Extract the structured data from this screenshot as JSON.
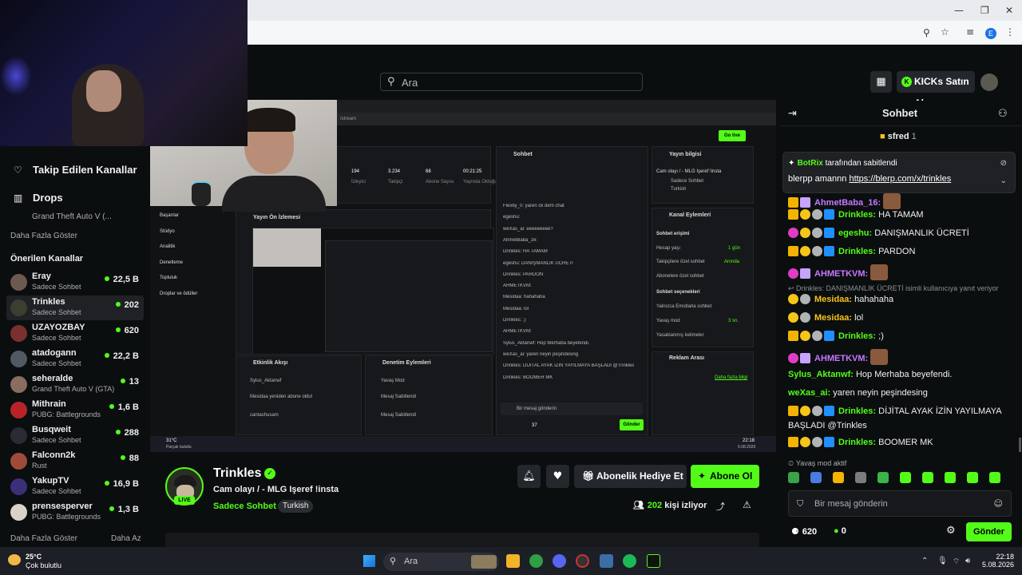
{
  "header": {
    "search_placeholder": "Ara",
    "kicks_button": "KICKs Satın Al"
  },
  "sidebar": {
    "followed": "Takip Edilen Kanallar",
    "drops": "Drops",
    "followed_category": "Grand Theft Auto V (...",
    "show_more_1": "Daha Fazla Göster",
    "recommended_title": "Önerilen Kanallar",
    "channels": [
      {
        "name": "Eray",
        "category": "Sadece Sohbet",
        "viewers": "22,5 B",
        "color": "#6d5a4e"
      },
      {
        "name": "Trinkles",
        "category": "Sadece Sohbet",
        "viewers": "202",
        "color": "#3a3f2f"
      },
      {
        "name": "UZAYOZBAY",
        "category": "Sadece Sohbet",
        "viewers": "620",
        "color": "#7a3030"
      },
      {
        "name": "atadogann",
        "category": "Sadece Sohbet",
        "viewers": "22,2 B",
        "color": "#4f5a62"
      },
      {
        "name": "seheralde",
        "category": "Grand Theft Auto V (GTA)",
        "viewers": "13",
        "color": "#8a6d5e"
      },
      {
        "name": "Mithrain",
        "category": "PUBG: Battlegrounds",
        "viewers": "1,6 B",
        "color": "#b8232a"
      },
      {
        "name": "Busqweit",
        "category": "Sadece Sohbet",
        "viewers": "288",
        "color": "#2b2b33"
      },
      {
        "name": "Falconn2k",
        "category": "Rust",
        "viewers": "88",
        "color": "#a14a3a"
      },
      {
        "name": "YakupTV",
        "category": "Sadece Sohbet",
        "viewers": "16,9 B",
        "color": "#3b2f7a"
      },
      {
        "name": "prensesperver",
        "category": "PUBG: Battlegrounds",
        "viewers": "1,3 B",
        "color": "#d8d3c8"
      }
    ],
    "show_more_2": "Daha Fazla Göster",
    "show_less": "Daha Az"
  },
  "stream_screen": {
    "url": "/stream",
    "go_live": "Go live",
    "stats": [
      {
        "value": "194",
        "label": "İzleyici"
      },
      {
        "value": "3.234",
        "label": "Takipçi"
      },
      {
        "value": "68",
        "label": "Abone Sayısı"
      },
      {
        "value": "00:21:25",
        "label": "Yayında Olduğu Süre"
      }
    ],
    "nav": [
      "Başarılar",
      "Stüdyo",
      "Analitik",
      "Denetleme",
      "Topluluk",
      "Droplar ve ödüller"
    ],
    "preview_title": "Yayın Ön İzlemesi",
    "chat_title": "Sohbet",
    "info_title": "Yayın bilgisi",
    "info_stream_title": "Cam olayı / - MLG Işeref !insta",
    "info_category": "Sadece Sohbet",
    "info_lang": "Turkish",
    "actions_title": "Kanal Eylemleri",
    "chat_access": "Sohbet erişimi",
    "account_age": "Hesap yaşı",
    "account_age_val": "1 gün",
    "followers_only": "Takipçilere özel sohbet",
    "followers_only_val": "Anında",
    "subs_only": "Abonelere özel sohbet",
    "chat_options": "Sohbet seçenekleri",
    "emotes_only": "Yalnızca Emotlarla sohbet",
    "slow_mode": "Yavaş mod",
    "slow_mode_val": "3 sn.",
    "banned_words": "Yasaklanmış kelimeler",
    "ad_title": "Reklam Arası",
    "ad_link": "Daha fazla bilgi",
    "activity_title": "Etkinlik Akışı",
    "activity": [
      "Sylus_Aktanwf",
      "Mesidaa yeniden abone oldu!",
      "cantashusam"
    ],
    "mod_title": "Denetim Eylemleri",
    "mod": [
      "Yavaş Mod",
      "Mesaj Sabitlendi",
      "Mesaj Sabitlendi"
    ],
    "mini_input": "Bir mesaj gönderin",
    "mini_send": "Gönder",
    "mini_points": "37",
    "mini_chat": [
      "Flexby_0: yaren ck dem chat",
      "egeshu:",
      "weXas_ai: eeeeeeeee?",
      "AhmetBaba_16:",
      "Drinkles: HA TAMAM",
      "egeshu: DANIŞMANLIK ÜCRETİ",
      "Drinkles: PARDON",
      "AHMETKVM:",
      "Mesidaa: hahahaha",
      "Mesidaa: lol",
      "Drinkles: ;)",
      "AHMETKVM:",
      "Sylus_Aktanwf: Hop Merhaba beyefendi.",
      "weXas_ai: yaren neyin peşindesing",
      "Drinkles: DİJİTAL AYAK İZİN YAYILMAYA BAŞLADI @Trinkles",
      "Drinkles: BOOMER MK"
    ],
    "taskbar_weather": "31°C",
    "taskbar_weather_desc": "Parçalı bulutlu",
    "taskbar_time": "22:18",
    "taskbar_date": "5.08.2026"
  },
  "channel": {
    "name": "Trinkles",
    "live": "LIVE",
    "title": "Cam olayı / - MLG Işeref !insta",
    "category": "Sadece Sohbet",
    "language": "Turkish",
    "gift_button": "Abonelik Hediye Et",
    "subscribe_button": "Abone Ol",
    "viewers": "202",
    "viewers_suffix": "kişi izliyor"
  },
  "chat": {
    "title": "Sohbet",
    "top_gifter": "sfred",
    "top_gifter_count": "1",
    "pinned_by": "BotRix",
    "pinned_suffix": "tarafından sabitlendi",
    "pinned_text": "blerpp amannn",
    "pinned_link": "https://blerp.com/x/trinkles",
    "partial_user": "AhmetBaba_16:",
    "messages": [
      {
        "user": "Drinkles:",
        "text": "HA TAMAM"
      },
      {
        "user": "egeshu:",
        "text": "DANIŞMANLIK ÜCRETİ"
      },
      {
        "user": "Drinkles:",
        "text": "PARDON"
      },
      {
        "user": "AHMETKVM:",
        "text": ""
      },
      {
        "user": "Mesidaa:",
        "text": "hahahaha"
      },
      {
        "user": "Mesidaa:",
        "text": "lol"
      },
      {
        "user": "Drinkles:",
        "text": ";)"
      },
      {
        "user": "AHMETKVM:",
        "text": ""
      },
      {
        "user": "Sylus_Aktanwf:",
        "text": "Hop Merhaba beyefendi."
      },
      {
        "user": "weXas_ai:",
        "text": "yaren neyin peşindesing"
      },
      {
        "user": "Drinkles:",
        "text": "DİJİTAL AYAK İZİN YAYILMAYA BAŞLADI @Trinkles"
      },
      {
        "user": "Drinkles:",
        "text": "BOOMER MK"
      }
    ],
    "reply_note": "Drinkles: DANIŞMANLIK ÜCRETİ isimli kullanıcıya yanıt veriyor",
    "slow_mode": "Yavaş mod aktif",
    "input_placeholder": "Bir mesaj gönderin",
    "kicks_balance": "620",
    "points": "0",
    "send_button": "Gönder"
  },
  "taskbar": {
    "temperature": "25°C",
    "weather": "Çok bulutlu",
    "search": "Ara",
    "time": "22:18",
    "date": "5.08.2026"
  }
}
